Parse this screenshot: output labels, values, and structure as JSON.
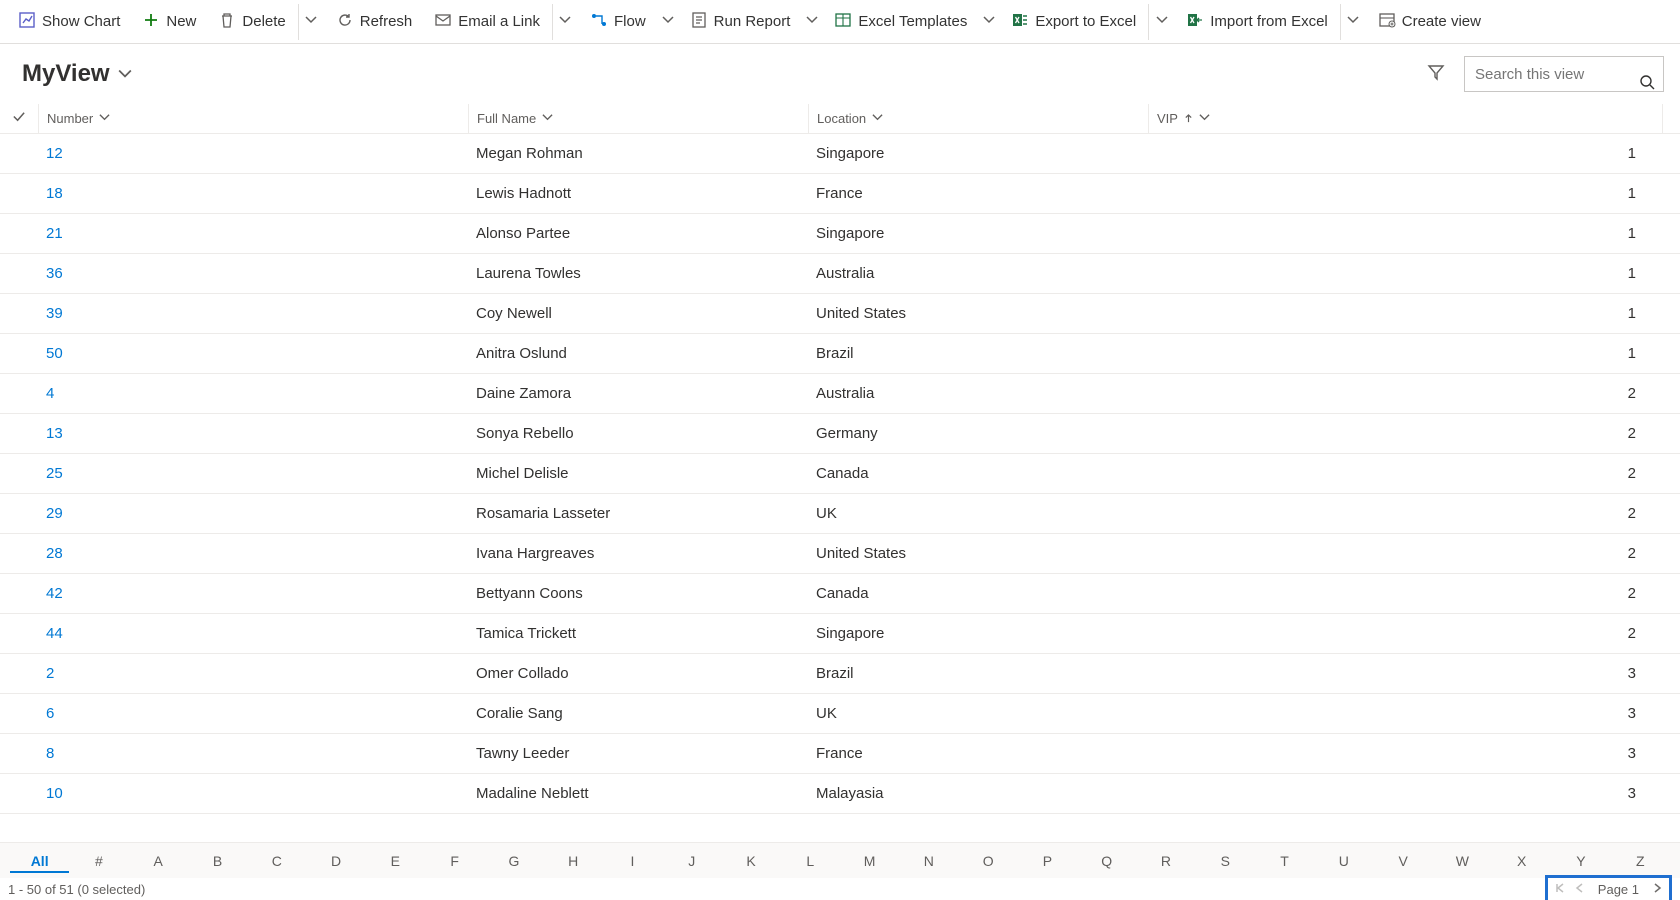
{
  "toolbar": {
    "show_chart": "Show Chart",
    "new": "New",
    "delete": "Delete",
    "refresh": "Refresh",
    "email_link": "Email a Link",
    "flow": "Flow",
    "run_report": "Run Report",
    "excel_templates": "Excel Templates",
    "export_excel": "Export to Excel",
    "import_excel": "Import from Excel",
    "create_view": "Create view"
  },
  "view": {
    "name": "MyView",
    "search_placeholder": "Search this view"
  },
  "columns": {
    "number": "Number",
    "full_name": "Full Name",
    "location": "Location",
    "vip": "VIP"
  },
  "rows": [
    {
      "number": "12",
      "name": "Megan Rohman",
      "location": "Singapore",
      "vip": "1"
    },
    {
      "number": "18",
      "name": "Lewis Hadnott",
      "location": "France",
      "vip": "1"
    },
    {
      "number": "21",
      "name": "Alonso Partee",
      "location": "Singapore",
      "vip": "1"
    },
    {
      "number": "36",
      "name": "Laurena Towles",
      "location": "Australia",
      "vip": "1"
    },
    {
      "number": "39",
      "name": "Coy Newell",
      "location": "United States",
      "vip": "1"
    },
    {
      "number": "50",
      "name": "Anitra Oslund",
      "location": "Brazil",
      "vip": "1"
    },
    {
      "number": "4",
      "name": "Daine Zamora",
      "location": "Australia",
      "vip": "2"
    },
    {
      "number": "13",
      "name": "Sonya Rebello",
      "location": "Germany",
      "vip": "2"
    },
    {
      "number": "25",
      "name": "Michel Delisle",
      "location": "Canada",
      "vip": "2"
    },
    {
      "number": "29",
      "name": "Rosamaria Lasseter",
      "location": "UK",
      "vip": "2"
    },
    {
      "number": "28",
      "name": "Ivana Hargreaves",
      "location": "United States",
      "vip": "2"
    },
    {
      "number": "42",
      "name": "Bettyann Coons",
      "location": "Canada",
      "vip": "2"
    },
    {
      "number": "44",
      "name": "Tamica Trickett",
      "location": "Singapore",
      "vip": "2"
    },
    {
      "number": "2",
      "name": "Omer Collado",
      "location": "Brazil",
      "vip": "3"
    },
    {
      "number": "6",
      "name": "Coralie Sang",
      "location": "UK",
      "vip": "3"
    },
    {
      "number": "8",
      "name": "Tawny Leeder",
      "location": "France",
      "vip": "3"
    },
    {
      "number": "10",
      "name": "Madaline Neblett",
      "location": "Malayasia",
      "vip": "3"
    }
  ],
  "alpha": {
    "all": "All",
    "hash": "#",
    "letters": [
      "A",
      "B",
      "C",
      "D",
      "E",
      "F",
      "G",
      "H",
      "I",
      "J",
      "K",
      "L",
      "M",
      "N",
      "O",
      "P",
      "Q",
      "R",
      "S",
      "T",
      "U",
      "V",
      "W",
      "X",
      "Y",
      "Z"
    ]
  },
  "footer": {
    "status": "1 - 50 of 51 (0 selected)",
    "page": "Page 1"
  }
}
